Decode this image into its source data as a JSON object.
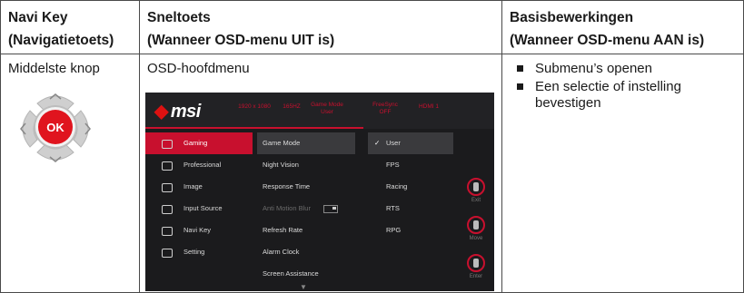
{
  "table": {
    "headers": {
      "col1": {
        "line1": "Navi Key",
        "line2": "(Navigatietoets)"
      },
      "col2": {
        "line1": "Sneltoets",
        "line2": "(Wanneer OSD-menu UIT is)"
      },
      "col3": {
        "line1": "Basisbewerkingen",
        "line2": "(Wanneer OSD-menu AAN is)"
      }
    },
    "row": {
      "col1": "Middelste knop",
      "col2": "OSD-hoofdmenu",
      "col3_items": [
        "Submenu’s openen",
        "Een selectie of instelling bevestigen"
      ]
    }
  },
  "navi_key": {
    "center_label": "OK",
    "center_color": "#e0141e"
  },
  "osd": {
    "brand": "msi",
    "accent_color": "#c8102e",
    "status": [
      {
        "line1": "1920 x 1080"
      },
      {
        "line1": "165HZ"
      },
      {
        "line1": "Game Mode",
        "line2": "User"
      },
      {
        "line1": "FreeSync",
        "line2": "OFF"
      },
      {
        "line1": "HDMI 1"
      }
    ],
    "side_menu": [
      "Gaming",
      "Professional",
      "Image",
      "Input Source",
      "Navi Key",
      "Setting"
    ],
    "side_icons": [
      "gamepad-icon",
      "star-icon",
      "image-icon",
      "input-source-icon",
      "navi-key-icon",
      "gear-icon"
    ],
    "mid_menu": [
      "Game Mode",
      "Night Vision",
      "Response Time",
      "Anti Motion Blur",
      "Refresh Rate",
      "Alarm Clock",
      "Screen Assistance"
    ],
    "right_menu": [
      "User",
      "FPS",
      "Racing",
      "RTS",
      "RPG"
    ],
    "keys": [
      "Exit",
      "Move",
      "Enter"
    ]
  }
}
